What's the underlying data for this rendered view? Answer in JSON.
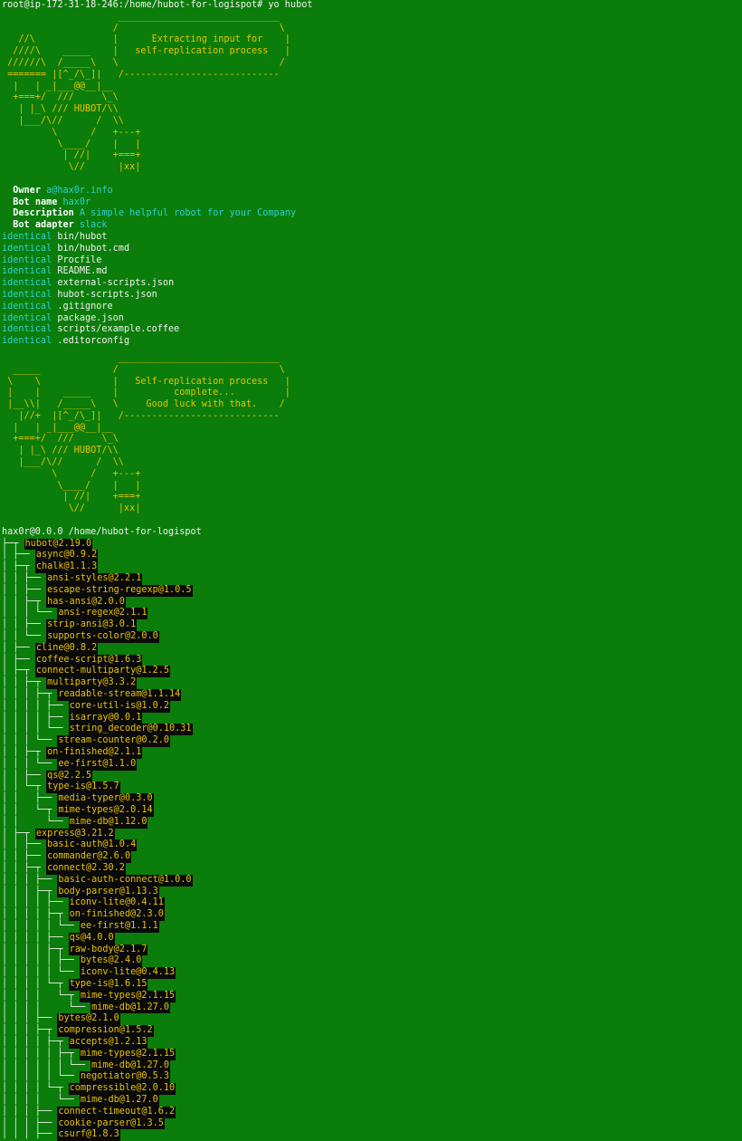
{
  "prompt_line": "root@ip-172-31-18-246:/home/hubot-for-logispot# yo hubot",
  "banner1": {
    "art_lines": [
      "                     _____________________________",
      "                    /                             \\",
      "   //\\              |      Extracting input for    |",
      "  ////\\    _____    |   self-replication process   |",
      " //////\\  /_____\\   \\                             /",
      " ======= |[^_/\\_]|   /----------------------------",
      "  |   | _|___@@__|__",
      "  +===+/  ///     \\_\\",
      "   | |_\\ /// HUBOT/\\\\",
      "   |___/\\//      /  \\\\",
      "         \\      /   +---+",
      "          \\____/    |   |",
      "           | //|    +===+",
      "            \\//      |xx|"
    ]
  },
  "info": {
    "owner_label": "Owner",
    "owner_value": "a@hax0r.info",
    "bot_name_label": "Bot name",
    "bot_name_value": "hax0r",
    "description_label": "Description",
    "description_value": "A simple helpful robot for your Company",
    "adapter_label": "Bot adapter",
    "adapter_value": "slack"
  },
  "files": [
    {
      "status": "identical",
      "path": "bin/hubot"
    },
    {
      "status": "identical",
      "path": "bin/hubot.cmd"
    },
    {
      "status": "identical",
      "path": "Procfile"
    },
    {
      "status": "identical",
      "path": "README.md"
    },
    {
      "status": "identical",
      "path": "external-scripts.json"
    },
    {
      "status": "identical",
      "path": "hubot-scripts.json"
    },
    {
      "status": "identical",
      "path": ".gitignore"
    },
    {
      "status": "identical",
      "path": "package.json"
    },
    {
      "status": "identical",
      "path": "scripts/example.coffee"
    },
    {
      "status": "identical",
      "path": ".editorconfig"
    }
  ],
  "banner2": {
    "art_lines": [
      "                     _____________________________",
      "  _____             /                             \\",
      " \\    \\             |   Self-replication process   |",
      " |    |    _____    |          complete...         |",
      " |__\\\\|   /_____\\   \\     Good luck with that.    /",
      "   |//+  |[^_/\\_]|   /----------------------------",
      "  |   | _|___@@__|__",
      "  +===+/  ///     \\_\\",
      "   | |_\\ /// HUBOT/\\\\",
      "   |___/\\//      /  \\\\",
      "         \\      /   +---+",
      "          \\____/    |   |",
      "           | //|    +===+",
      "            \\//      |xx|"
    ]
  },
  "tree_root": "hax0r@0.0.0 /home/hubot-for-logispot",
  "tree": [
    {
      "prefix": "├─┬ ",
      "name": "hubot@2.19.0"
    },
    {
      "prefix": "│ ├── ",
      "name": "async@0.9.2"
    },
    {
      "prefix": "│ ├─┬ ",
      "name": "chalk@1.1.3"
    },
    {
      "prefix": "│ │ ├── ",
      "name": "ansi-styles@2.2.1"
    },
    {
      "prefix": "│ │ ├── ",
      "name": "escape-string-regexp@1.0.5"
    },
    {
      "prefix": "│ │ ├─┬ ",
      "name": "has-ansi@2.0.0"
    },
    {
      "prefix": "│ │ │ └── ",
      "name": "ansi-regex@2.1.1"
    },
    {
      "prefix": "│ │ ├── ",
      "name": "strip-ansi@3.0.1"
    },
    {
      "prefix": "│ │ └── ",
      "name": "supports-color@2.0.0"
    },
    {
      "prefix": "│ ├── ",
      "name": "cline@0.8.2"
    },
    {
      "prefix": "│ ├── ",
      "name": "coffee-script@1.6.3"
    },
    {
      "prefix": "│ ├─┬ ",
      "name": "connect-multiparty@1.2.5"
    },
    {
      "prefix": "│ │ ├─┬ ",
      "name": "multiparty@3.3.2"
    },
    {
      "prefix": "│ │ │ ├─┬ ",
      "name": "readable-stream@1.1.14"
    },
    {
      "prefix": "│ │ │ │ ├── ",
      "name": "core-util-is@1.0.2"
    },
    {
      "prefix": "│ │ │ │ ├── ",
      "name": "isarray@0.0.1"
    },
    {
      "prefix": "│ │ │ │ └── ",
      "name": "string_decoder@0.10.31"
    },
    {
      "prefix": "│ │ │ └── ",
      "name": "stream-counter@0.2.0"
    },
    {
      "prefix": "│ │ ├─┬ ",
      "name": "on-finished@2.1.1"
    },
    {
      "prefix": "│ │ │ └── ",
      "name": "ee-first@1.1.0"
    },
    {
      "prefix": "│ │ ├── ",
      "name": "qs@2.2.5"
    },
    {
      "prefix": "│ │ └─┬ ",
      "name": "type-is@1.5.7"
    },
    {
      "prefix": "│ │   ├── ",
      "name": "media-typer@0.3.0"
    },
    {
      "prefix": "│ │   └─┬ ",
      "name": "mime-types@2.0.14"
    },
    {
      "prefix": "│ │     └── ",
      "name": "mime-db@1.12.0"
    },
    {
      "prefix": "│ ├─┬ ",
      "name": "express@3.21.2"
    },
    {
      "prefix": "│ │ ├── ",
      "name": "basic-auth@1.0.4"
    },
    {
      "prefix": "│ │ ├── ",
      "name": "commander@2.6.0"
    },
    {
      "prefix": "│ │ ├─┬ ",
      "name": "connect@2.30.2"
    },
    {
      "prefix": "│ │ │ ├── ",
      "name": "basic-auth-connect@1.0.0"
    },
    {
      "prefix": "│ │ │ ├─┬ ",
      "name": "body-parser@1.13.3"
    },
    {
      "prefix": "│ │ │ │ ├── ",
      "name": "iconv-lite@0.4.11"
    },
    {
      "prefix": "│ │ │ │ ├─┬ ",
      "name": "on-finished@2.3.0"
    },
    {
      "prefix": "│ │ │ │ │ └── ",
      "name": "ee-first@1.1.1"
    },
    {
      "prefix": "│ │ │ │ ├── ",
      "name": "qs@4.0.0"
    },
    {
      "prefix": "│ │ │ │ ├─┬ ",
      "name": "raw-body@2.1.7"
    },
    {
      "prefix": "│ │ │ │ │ ├── ",
      "name": "bytes@2.4.0"
    },
    {
      "prefix": "│ │ │ │ │ └── ",
      "name": "iconv-lite@0.4.13"
    },
    {
      "prefix": "│ │ │ │ └─┬ ",
      "name": "type-is@1.6.15"
    },
    {
      "prefix": "│ │ │ │   └─┬ ",
      "name": "mime-types@2.1.15"
    },
    {
      "prefix": "│ │ │ │     └── ",
      "name": "mime-db@1.27.0"
    },
    {
      "prefix": "│ │ │ ├── ",
      "name": "bytes@2.1.0"
    },
    {
      "prefix": "│ │ │ ├─┬ ",
      "name": "compression@1.5.2"
    },
    {
      "prefix": "│ │ │ │ ├─┬ ",
      "name": "accepts@1.2.13"
    },
    {
      "prefix": "│ │ │ │ │ ├─┬ ",
      "name": "mime-types@2.1.15"
    },
    {
      "prefix": "│ │ │ │ │ │ └── ",
      "name": "mime-db@1.27.0"
    },
    {
      "prefix": "│ │ │ │ │ └── ",
      "name": "negotiator@0.5.3"
    },
    {
      "prefix": "│ │ │ │ └─┬ ",
      "name": "compressible@2.0.10"
    },
    {
      "prefix": "│ │ │ │   └── ",
      "name": "mime-db@1.27.0"
    },
    {
      "prefix": "│ │ │ ├── ",
      "name": "connect-timeout@1.6.2"
    },
    {
      "prefix": "│ │ │ ├── ",
      "name": "cookie-parser@1.3.5"
    },
    {
      "prefix": "│ │ │ ├── ",
      "name": "csurf@1.8.3"
    }
  ]
}
